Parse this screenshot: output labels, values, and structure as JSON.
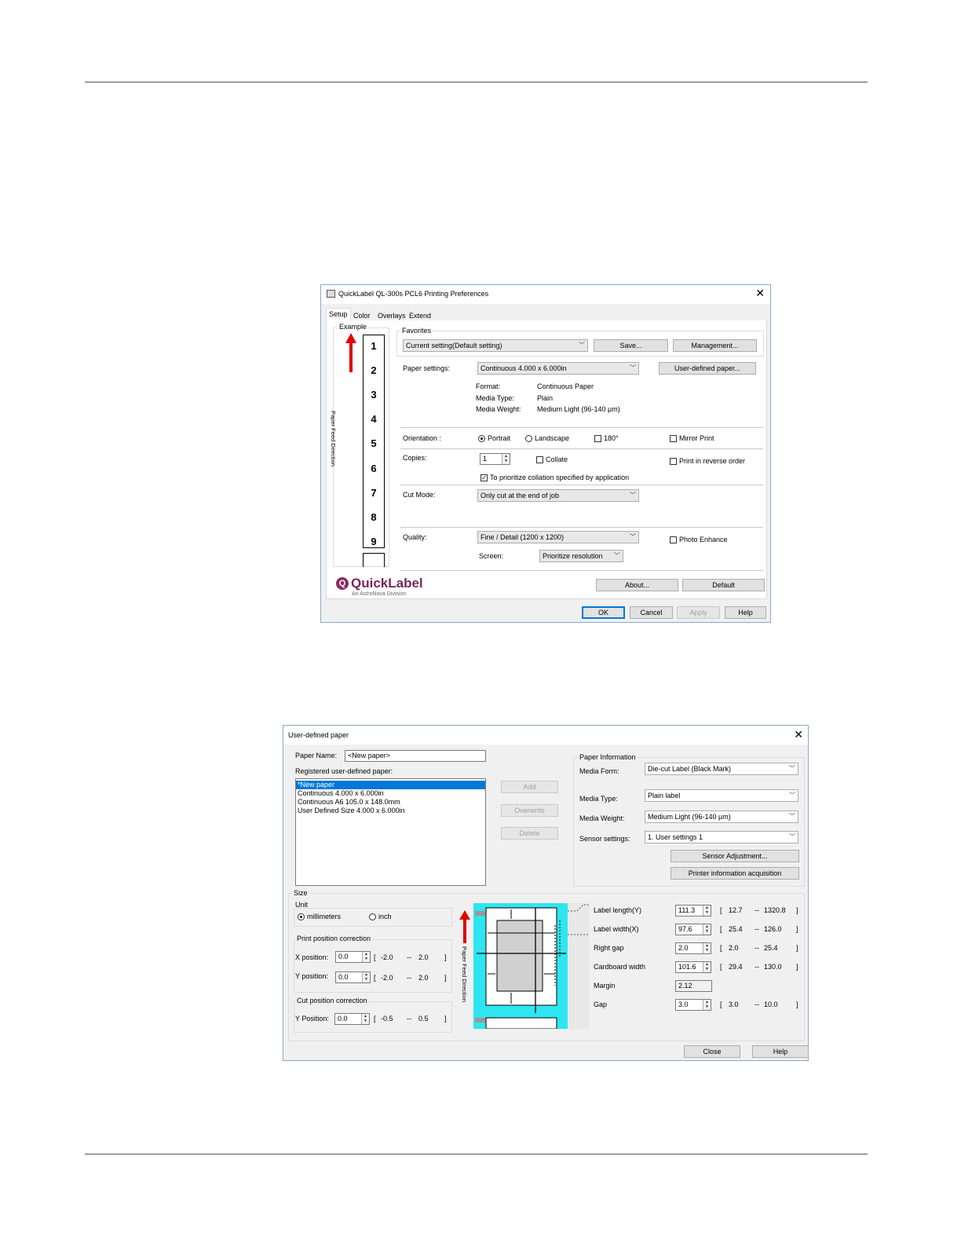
{
  "dialog1": {
    "title": "QuickLabel QL-300s PCL6 Printing Preferences",
    "tabs": [
      "Setup",
      "Color",
      "Overlays",
      "Extend"
    ],
    "example_label": "Example",
    "feed_direction": "Paper Feed Direction",
    "example_numbers": [
      "1",
      "2",
      "3",
      "4",
      "5",
      "6",
      "7",
      "8",
      "9"
    ],
    "favorites": {
      "label": "Favorites",
      "value": "Current setting(Default setting)",
      "save": "Save...",
      "management": "Management..."
    },
    "paper_settings": {
      "label": "Paper settings:",
      "value": "Continuous 4.000 x 6.000in",
      "user_defined": "User-defined paper..."
    },
    "info": {
      "format_label": "Format:",
      "format_value": "Continuous Paper",
      "media_type_label": "Media Type:",
      "media_type_value": "Plain",
      "media_weight_label": "Media Weight:",
      "media_weight_value": "Medium Light (96-140 µm)"
    },
    "orientation": {
      "label": "Orientation :",
      "portrait": "Portrait",
      "landscape": "Landscape",
      "rotate": "180°",
      "mirror": "Mirror Print"
    },
    "copies": {
      "label": "Copies:",
      "value": "1",
      "collate": "Collate",
      "reverse": "Print in reverse order",
      "prioritize": "To prioritize collation specified by application"
    },
    "cut_mode": {
      "label": "Cut Mode:",
      "value": "Only cut at the end of job"
    },
    "quality": {
      "label": "Quality:",
      "value": "Fine / Detail (1200 x 1200)",
      "photo": "Photo Enhance",
      "screen_label": "Screen:",
      "screen_value": "Prioritize resolution"
    },
    "logo": {
      "name": "QuickLabel",
      "sub": "An AstroNova Division"
    },
    "buttons": {
      "about": "About...",
      "default": "Default",
      "ok": "OK",
      "cancel": "Cancel",
      "apply": "Apply",
      "help": "Help"
    },
    "colors": {
      "feed_arrow": "#e00000",
      "accent": "#0078d7"
    }
  },
  "dialog2": {
    "title": "User-defined paper",
    "paper_name_label": "Paper Name:",
    "paper_name_value": "<New paper>",
    "registered_label": "Registered user-defined paper:",
    "registered_items": [
      "*New paper",
      "Continuous 4.000 x 6.000in",
      "Continuous A6 105.0 x 148.0mm",
      "User Defined Size 4.000 x 6.000in"
    ],
    "buttons": {
      "add": "Add",
      "overwrite": "Overwrite",
      "delete": "Delete",
      "sensor_adjust": "Sensor Adjustment...",
      "printer_info": "Printer information acquisition",
      "close": "Close",
      "help": "Help"
    },
    "paper_info": {
      "label": "Paper Information",
      "media_form_label": "Media Form:",
      "media_form_value": "Die-cut Label (Black Mark)",
      "media_type_label": "Media Type:",
      "media_type_value": "Plain label",
      "media_weight_label": "Media Weight:",
      "media_weight_value": "Medium Light (96-140 µm)",
      "sensor_label": "Sensor settings:",
      "sensor_value": "1. User settings 1"
    },
    "size": {
      "label": "Size",
      "unit_label": "Unit",
      "mm": "millimeters",
      "inch": "inch",
      "print_pos_label": "Print position correction",
      "x_pos_label": "X position:",
      "x_pos_value": "0.0",
      "x_min": "-2.0",
      "x_max": "2.0",
      "y_pos_label": "Y position:",
      "y_pos_value": "0.0",
      "y_min": "-2.0",
      "y_max": "2.0",
      "cut_pos_label": "Cut position correction",
      "cut_y_label": "Y Position:",
      "cut_y_value": "0.0",
      "cut_min": "-0.5",
      "cut_max": "0.5",
      "feed_direction": "Paper Feed Direction"
    },
    "dimensions": [
      {
        "label": "Label length(Y)",
        "value": "111.3",
        "min": "12.7",
        "max": "1320.8"
      },
      {
        "label": "Label width(X)",
        "value": "97.6",
        "min": "25.4",
        "max": "126.0"
      },
      {
        "label": "Right gap",
        "value": "2.0",
        "min": "2.0",
        "max": "25.4"
      },
      {
        "label": "Cardboard width",
        "value": "101.6",
        "min": "29.4",
        "max": "130.0"
      },
      {
        "label": "Margin",
        "value": "2.12",
        "min": "",
        "max": ""
      },
      {
        "label": "Gap",
        "value": "3.0",
        "min": "3.0",
        "max": "10.0"
      }
    ],
    "colors": {
      "diagram_bg": "#2ee6f0",
      "selection": "#0078d7"
    }
  }
}
